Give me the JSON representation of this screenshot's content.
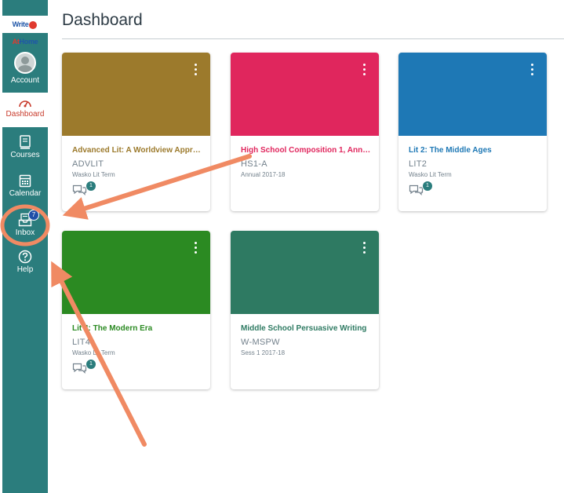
{
  "brand": {
    "text_left": "Write",
    "text_mid": "At",
    "text_right": "Home"
  },
  "nav": {
    "items": [
      {
        "label": "Account",
        "icon": "user-avatar-icon"
      },
      {
        "label": "Dashboard",
        "icon": "dashboard-gauge-icon",
        "active": true
      },
      {
        "label": "Courses",
        "icon": "courses-book-icon"
      },
      {
        "label": "Calendar",
        "icon": "calendar-icon"
      },
      {
        "label": "Inbox",
        "icon": "inbox-tray-icon",
        "badge": "7"
      },
      {
        "label": "Help",
        "icon": "help-question-icon"
      }
    ]
  },
  "header": {
    "title": "Dashboard"
  },
  "cards": [
    {
      "name": "Advanced Lit: A Worldview Appro...",
      "code": "ADVLIT",
      "term": "Wasko Lit Term",
      "color": "#9c7a2c",
      "name_color": "#9c7a2c",
      "discussions": "1"
    },
    {
      "name": "High School Composition 1, Annual",
      "code": "HS1-A",
      "term": "Annual 2017-18",
      "color": "#e0265d",
      "name_color": "#e0265d",
      "discussions": ""
    },
    {
      "name": "Lit 2: The Middle Ages",
      "code": "LIT2",
      "term": "Wasko Lit Term",
      "color": "#1e78b5",
      "name_color": "#1e78b5",
      "discussions": "1"
    },
    {
      "name": "Lit 4: The Modern Era",
      "code": "LIT4",
      "term": "Wasko Lit Term",
      "color": "#2b8a22",
      "name_color": "#2b8a22",
      "discussions": "1"
    },
    {
      "name": "Middle School Persuasive Writing",
      "code": "W-MSPW",
      "term": "Sess 1 2017-18",
      "color": "#2e7a62",
      "name_color": "#2e7a62",
      "discussions": ""
    }
  ],
  "annotation": {
    "color": "#f08a63"
  }
}
